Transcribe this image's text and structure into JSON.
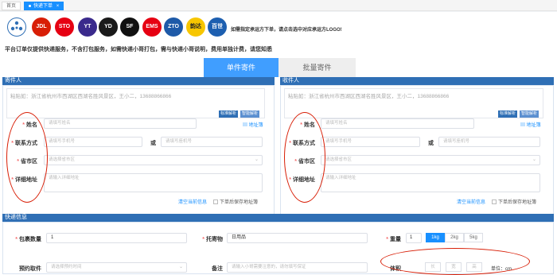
{
  "tabs": [
    {
      "label": "首页"
    },
    {
      "label": "快递下单",
      "close": "×"
    }
  ],
  "carriers": {
    "items": [
      {
        "label": "JDL",
        "color": "#d81e06"
      },
      {
        "label": "STO",
        "color": "#e60012"
      },
      {
        "label": "YT",
        "color": "#3a2a8c"
      },
      {
        "label": "YD",
        "color": "#1a1a1a"
      },
      {
        "label": "SF",
        "color": "#111111"
      },
      {
        "label": "EMS",
        "color": "#e60012"
      },
      {
        "label": "ZTO",
        "color": "#1e5aa8"
      },
      {
        "label": "韵达",
        "color": "#f7c600"
      },
      {
        "label": "百世",
        "color": "#1d5fb0"
      }
    ],
    "hint": "如需指定承运方下单，请点击选中对应承运方LOGO!"
  },
  "notice": "平台订单仅提供快递服务，不含打包服务，如需快递小哥打包，需与快递小哥说明，费用单独计费，请您知悉",
  "mode_tabs": {
    "single": "单件寄件",
    "batch": "批量寄件"
  },
  "sender": {
    "title": "寄件人",
    "paste_placeholder": "粘贴如：浙江省杭州市西湖区西湖名胜风景区，王小二，13688866866",
    "btn_standard": "标准解析",
    "btn_smart": "智能解析",
    "labels": {
      "name": "姓名",
      "contact": "联系方式",
      "region": "省市区",
      "address": "详细地址"
    },
    "placeholders": {
      "name": "请填写姓名",
      "phone": "请填写手机号",
      "landline": "请填写座机号",
      "region": "请选择省市区",
      "address": "请输入详细地址"
    },
    "or": "或",
    "address_book": "地址簿",
    "clear": "清空当前信息",
    "save": "下单后保存地址簿"
  },
  "receiver": {
    "title": "收件人",
    "paste_placeholder": "粘贴如：浙江省杭州市西湖区西湖名胜风景区，王小二，13688866866",
    "btn_standard": "标准解析",
    "btn_smart": "智能解析",
    "labels": {
      "name": "姓名",
      "contact": "联系方式",
      "region": "省市区",
      "address": "详细地址"
    },
    "placeholders": {
      "name": "请填写姓名",
      "phone": "请填写手机号",
      "landline": "请填写座机号",
      "region": "请选择省市区",
      "address": "请输入详细地址"
    },
    "or": "或",
    "address_book": "地址簿",
    "clear": "清空当前信息",
    "save": "下单后保存地址簿"
  },
  "express": {
    "title": "快递信息",
    "package_count_label": "包裹数量",
    "package_count_value": "1",
    "item_label": "托寄物",
    "item_value": "日用品",
    "weight_label": "重量",
    "weight_value": "1",
    "weight_options": [
      "1kg",
      "2kg",
      "5kg"
    ],
    "weight_selected": "1kg",
    "pickup_label": "预约取件",
    "pickup_placeholder": "请选择预约时间",
    "remark_label": "备注",
    "remark_placeholder": "请输入小哥需要注意的，请勿填写保证",
    "volume_label": "体积",
    "dims": [
      "长",
      "宽",
      "高"
    ],
    "unit_label": "单位：cm"
  },
  "colors": {
    "accent": "#1890ff",
    "panel_header": "#2f6fb5",
    "annotation": "#d81e06"
  }
}
